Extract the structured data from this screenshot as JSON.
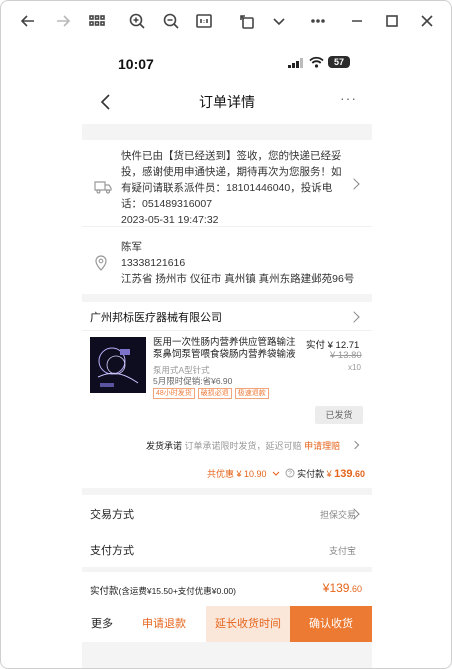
{
  "phone": {
    "status_time": "10:07",
    "battery": "57"
  },
  "nav": {
    "title": "订单详情",
    "more": "···"
  },
  "logistics": {
    "message": "快件已由【货已经送到】签收，您的快递已经妥投，感谢使用申通快递，期待再次为您服务！如有疑问请联系派件员：18101446040，投诉电话：051489316007",
    "time": "2023-05-31 19:47:32"
  },
  "address": {
    "name": "陈军",
    "phone": "13338121616",
    "detail": "江苏省 扬州市 仪征市 真州镇 真州东路建邺苑96号"
  },
  "shop": {
    "name": "广州邦标医疗器械有限公司",
    "product": {
      "title": "医用一次性肠内营养供应管路输注泵鼻饲泵管喂食袋肠内营养袋输液",
      "price": "实付 ¥ 12.71",
      "original_price": "¥ 13.80",
      "quantity": "x10",
      "spec": "泵用式A型针式",
      "promo": "5月限时促销:省¥6.90",
      "tags": [
        "48小时发货",
        "破损必退",
        "极速退款"
      ],
      "status_button": "已发货"
    },
    "promise": {
      "label": "发货承诺",
      "text": "订单承诺限时发货，延迟可赔",
      "link": "申请理赔"
    },
    "summary": {
      "discount": "共优惠 ¥ 10.90",
      "paid_label": "实付款",
      "paid_yen": "¥",
      "paid_int": "139",
      "paid_dec": ".60"
    }
  },
  "trade": {
    "label": "交易方式",
    "value": "担保交易"
  },
  "pay": {
    "label": "支付方式",
    "value": "支付宝"
  },
  "bottom": {
    "total_label": "实付款",
    "total_detail": "(含运费¥15.50+支付优惠¥0.00)",
    "total_amount": "¥139",
    "total_amount_dec": ".60",
    "actions": {
      "more": "更多",
      "refund": "申请退款",
      "extend": "延长收货时间",
      "confirm": "确认收货"
    }
  },
  "colors": {
    "accent": "#ec7a32",
    "accent_text": "#e5641b"
  }
}
